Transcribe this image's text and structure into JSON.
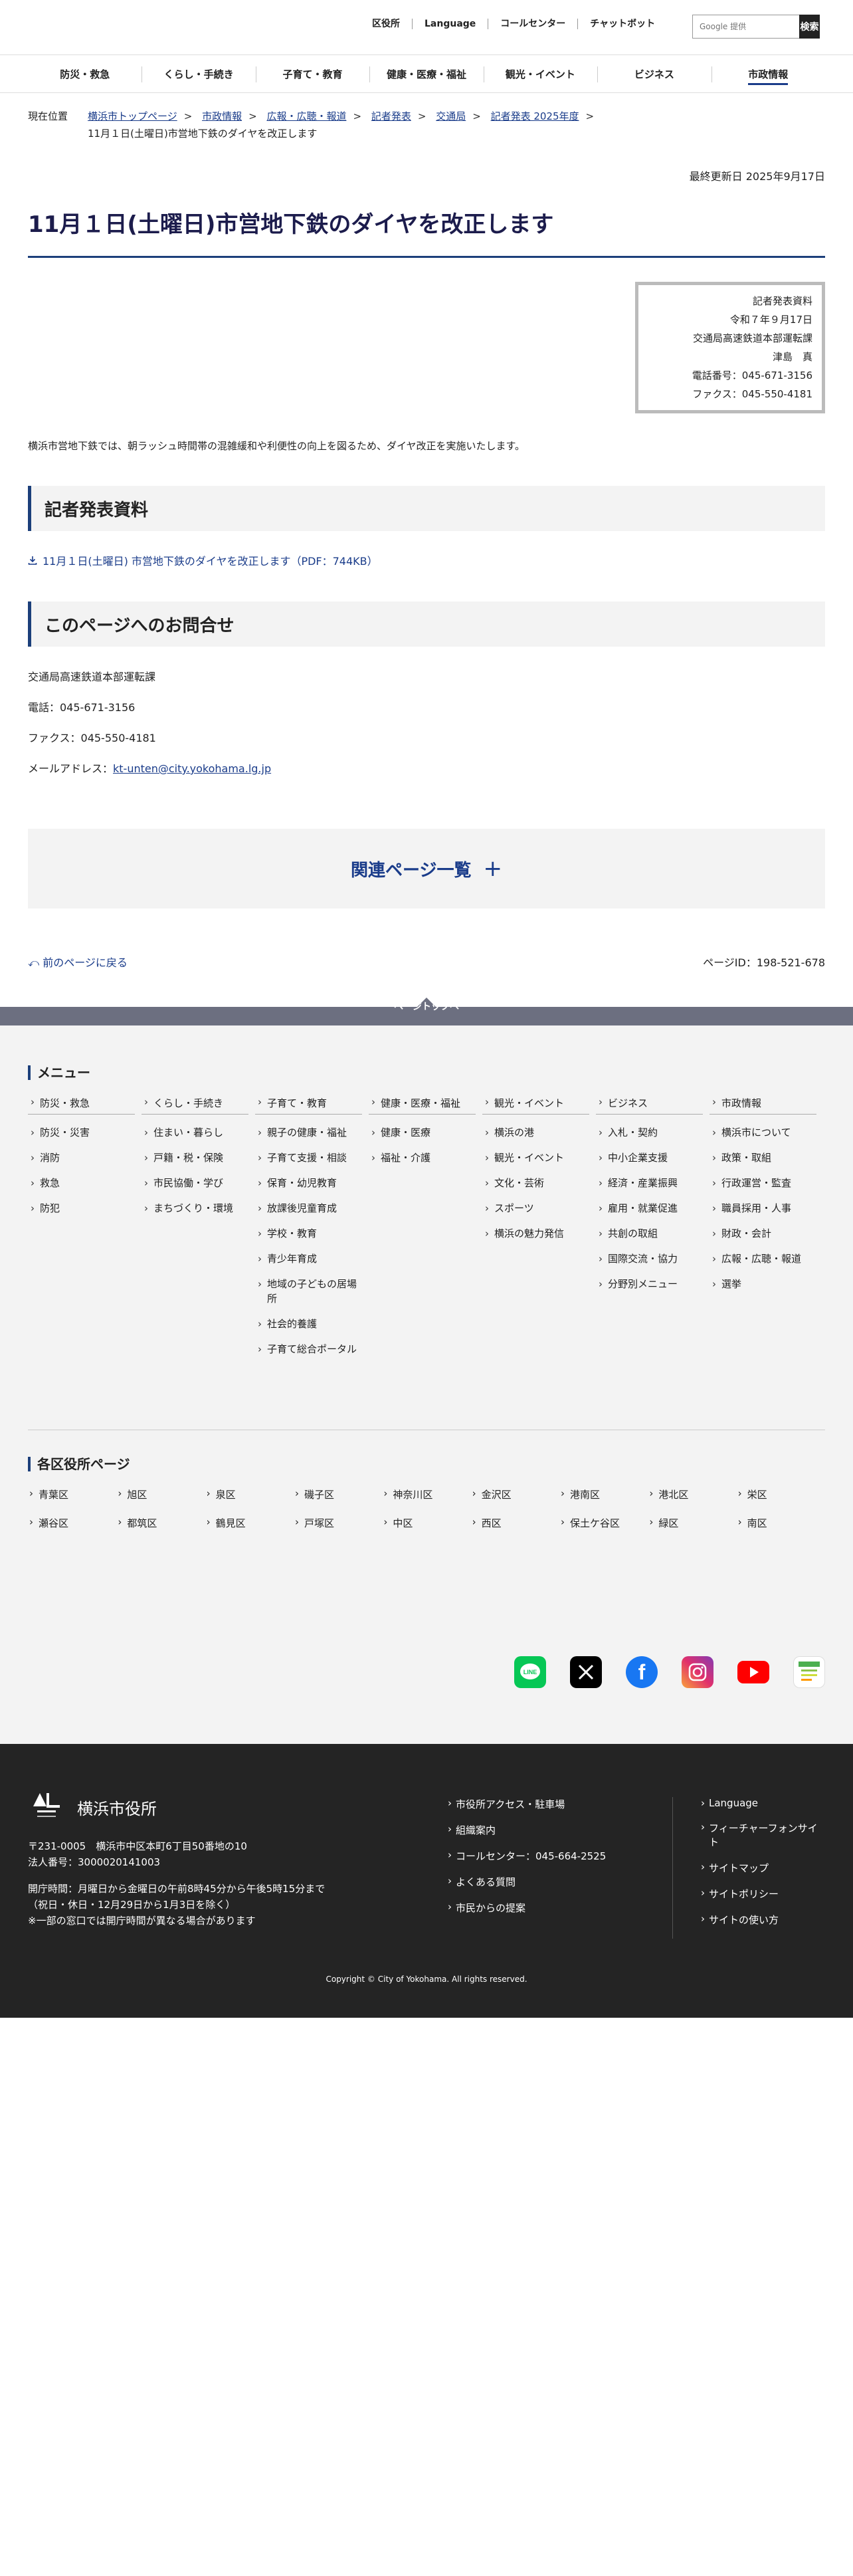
{
  "header": {
    "links": [
      "区役所",
      "Language",
      "コールセンター",
      "チャットボット"
    ],
    "search_placeholder": "Google 提供",
    "search_button": "検索"
  },
  "gnav": [
    "防災・救急",
    "くらし・手続き",
    "子育て・教育",
    "健康・医療・福祉",
    "観光・イベント",
    "ビジネス",
    "市政情報"
  ],
  "breadcrumb": {
    "label": "現在位置",
    "items": [
      "横浜市トップページ",
      "市政情報",
      "広報・広聴・報道",
      "記者発表",
      "交通局",
      "記者発表 2025年度"
    ],
    "current": "11月１日(土曜日)市営地下鉄のダイヤを改正します"
  },
  "updated": "最終更新日 2025年9月17日",
  "title": "11月１日(土曜日)市営地下鉄のダイヤを改正します",
  "press_box": {
    "lines": [
      "記者発表資料",
      "令和７年９月17日",
      "交通局高速鉄道本部運転課",
      "津島　真",
      "電話番号：045-671-3156",
      "ファクス：045-550-4181"
    ]
  },
  "intro": "横浜市営地下鉄では、朝ラッシュ時間帯の混雑緩和や利便性の向上を図るため、ダイヤ改正を実施いたします。",
  "section1": {
    "heading": "記者発表資料",
    "pdf_link": "11月１日(土曜日) 市営地下鉄のダイヤを改正します（PDF：744KB）"
  },
  "section2": {
    "heading": "このページへのお問合せ",
    "org": "交通局高速鉄道本部運転課",
    "tel": "電話：045-671-3156",
    "fax": "ファクス：045-550-4181",
    "mail_label": "メールアドレス：",
    "mail": "kt-unten@city.yokohama.lg.jp"
  },
  "related": "関連ページ一覧",
  "back": "前のページに戻る",
  "page_id": "ページID：198-521-678",
  "pagetop": "ページトップへ",
  "footer_menu": {
    "title": "メニュー",
    "cols": [
      {
        "head": "防災・救急",
        "items": [
          "防災・災害",
          "消防",
          "救急",
          "防犯"
        ]
      },
      {
        "head": "くらし・手続き",
        "items": [
          "住まい・暮らし",
          "戸籍・税・保険",
          "市民協働・学び",
          "まちづくり・環境"
        ]
      },
      {
        "head": "子育て・教育",
        "items": [
          "親子の健康・福祉",
          "子育て支援・相談",
          "保育・幼児教育",
          "放課後児童育成",
          "学校・教育",
          "青少年育成",
          "地域の子どもの居場所",
          "社会的養護",
          "子育て総合ポータル"
        ]
      },
      {
        "head": "健康・医療・福祉",
        "items": [
          "健康・医療",
          "福祉・介護"
        ]
      },
      {
        "head": "観光・イベント",
        "items": [
          "横浜の港",
          "観光・イベント",
          "文化・芸術",
          "スポーツ",
          "横浜の魅力発信"
        ]
      },
      {
        "head": "ビジネス",
        "items": [
          "入札・契約",
          "中小企業支援",
          "経済・産業振興",
          "雇用・就業促進",
          "共創の取組",
          "国際交流・協力",
          "分野別メニュー"
        ]
      },
      {
        "head": "市政情報",
        "items": [
          "横浜市について",
          "政策・取組",
          "行政運営・監査",
          "職員採用・人事",
          "財政・会計",
          "広報・広聴・報道",
          "選挙"
        ]
      }
    ]
  },
  "wards": {
    "title": "各区役所ページ",
    "items": [
      "青葉区",
      "旭区",
      "泉区",
      "磯子区",
      "神奈川区",
      "金沢区",
      "港南区",
      "港北区",
      "栄区",
      "瀬谷区",
      "都筑区",
      "鶴見区",
      "戸塚区",
      "中区",
      "西区",
      "保土ケ谷区",
      "緑区",
      "南区"
    ]
  },
  "social": [
    "LINE",
    "X",
    "Facebook",
    "Instagram",
    "YouTube",
    "広報紙"
  ],
  "footer": {
    "city": "横浜市役所",
    "address": "〒231-0005　横浜市中区本町6丁目50番地の10",
    "corp_no": "法人番号：3000020141003",
    "hours1": "開庁時間：月曜日から金曜日の午前8時45分から午後5時15分まで",
    "hours2": "（祝日・休日・12月29日から1月3日を除く）",
    "hours3": "※一部の窓口では開庁時間が異なる場合があります",
    "links_left": [
      "市役所アクセス・駐車場",
      "組織案内",
      "コールセンター：045-664-2525",
      "よくある質問",
      "市民からの提案"
    ],
    "links_right": [
      "Language",
      "フィーチャーフォンサイト",
      "サイトマップ",
      "サイトポリシー",
      "サイトの使い方"
    ],
    "copyright": "Copyright © City of Yokohama. All rights reserved."
  }
}
